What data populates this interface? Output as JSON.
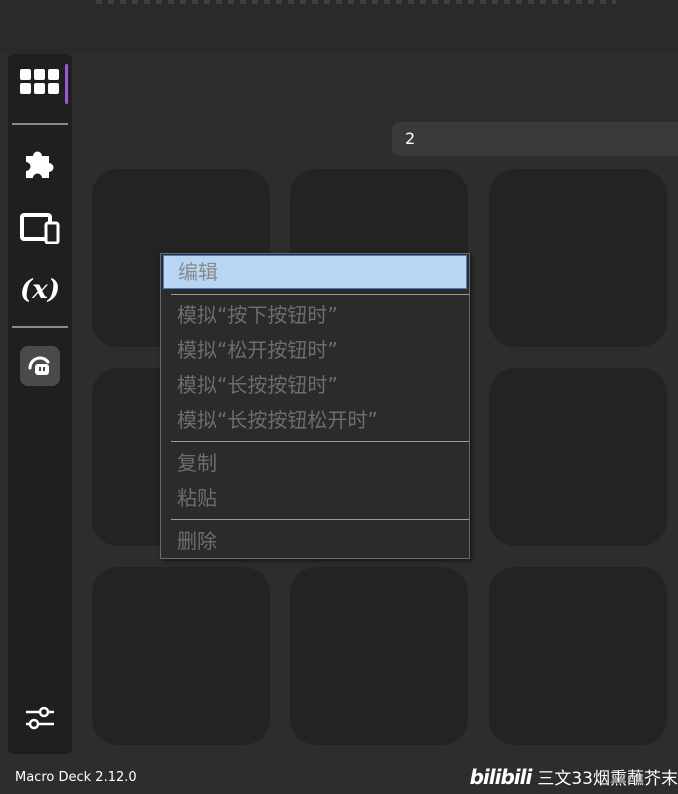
{
  "app": {
    "folder_name": "2",
    "version": "Macro Deck 2.12.0"
  },
  "sidebar": {
    "items": [
      {
        "id": "deck",
        "icon": "grid-icon",
        "active": true
      },
      {
        "id": "plugins",
        "icon": "puzzle-icon"
      },
      {
        "id": "devices",
        "icon": "devices-icon"
      },
      {
        "id": "variables",
        "icon": "variables-icon",
        "label": "(x)"
      },
      {
        "id": "profile",
        "icon": "profile-icon"
      },
      {
        "id": "settings",
        "icon": "sliders-icon"
      }
    ],
    "accent_color": "#9b59d6"
  },
  "context_menu": {
    "edit": "编辑",
    "sim_press": "模拟“按下按钮时”",
    "sim_release": "模拟“松开按钮时”",
    "sim_long_press": "模拟“长按按钮时”",
    "sim_long_release": "模拟“长按按钮松开时”",
    "copy": "复制",
    "paste": "粘贴",
    "delete": "删除"
  },
  "watermark": {
    "logo": "bilibili",
    "author": "三文33烟熏蘸芥末"
  }
}
